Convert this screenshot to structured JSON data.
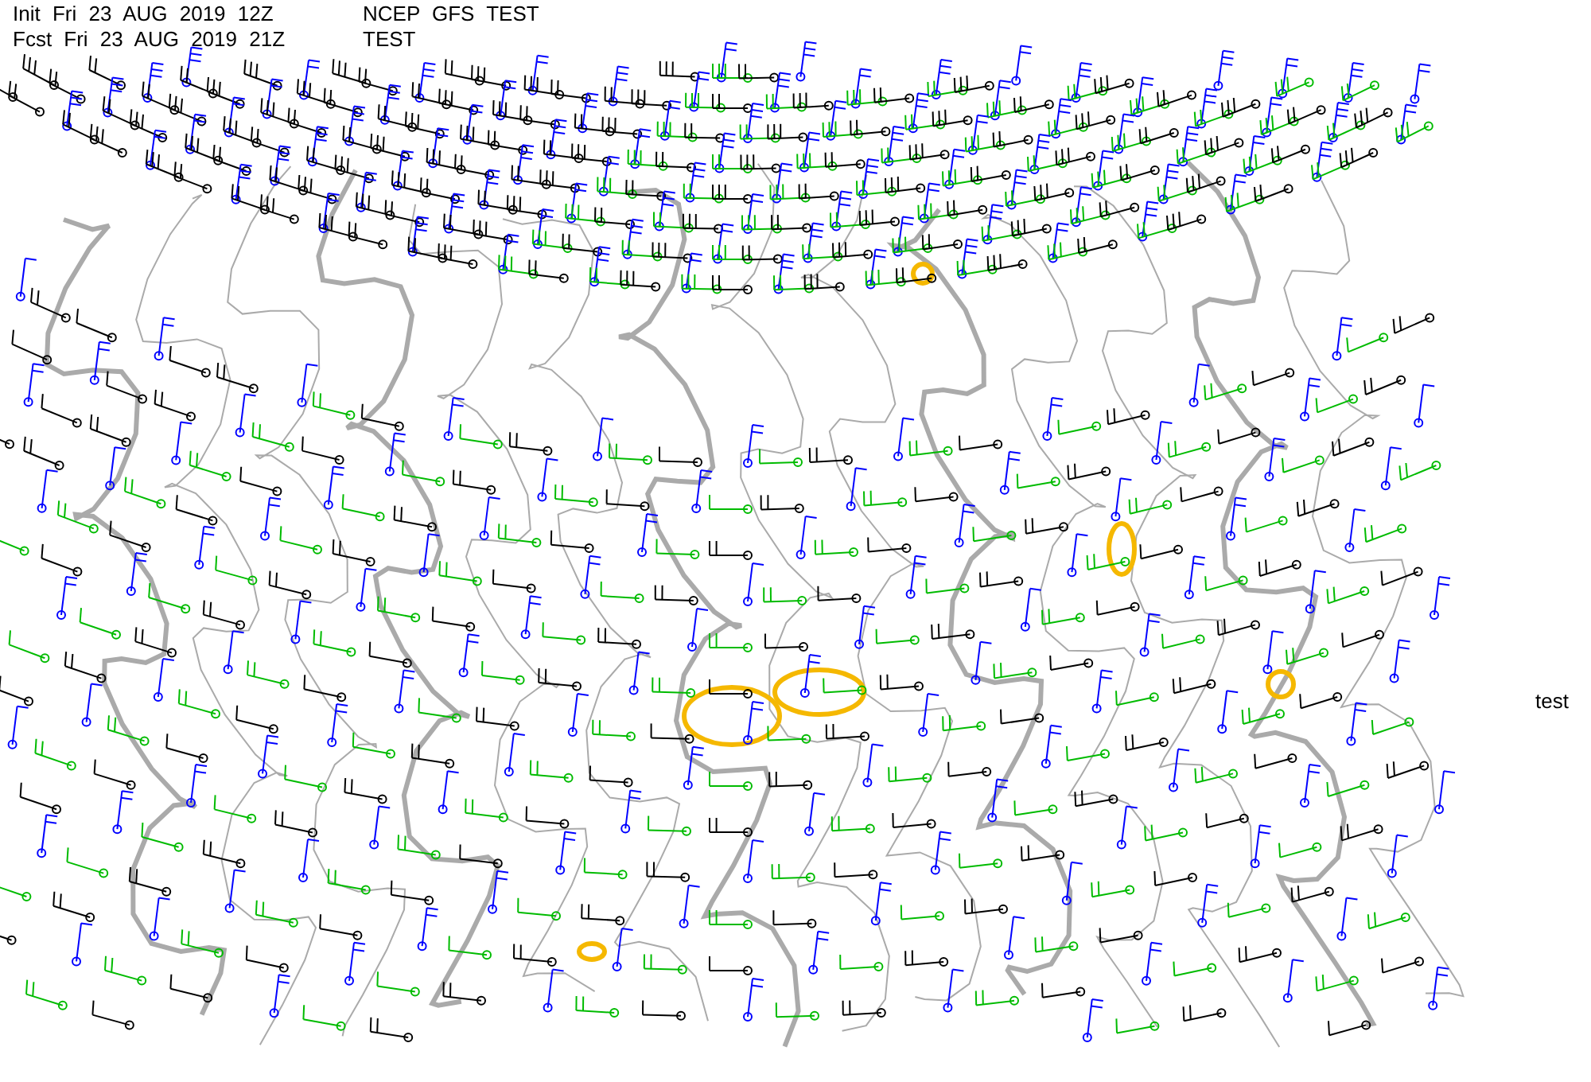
{
  "header": [
    {
      "left": "Init Fri 23 AUG 2019 12Z",
      "right": "NCEP GFS TEST"
    },
    {
      "left": "Fcst Fri 23 AUG 2019 21Z",
      "right": "TEST"
    }
  ],
  "side_label": "test"
}
